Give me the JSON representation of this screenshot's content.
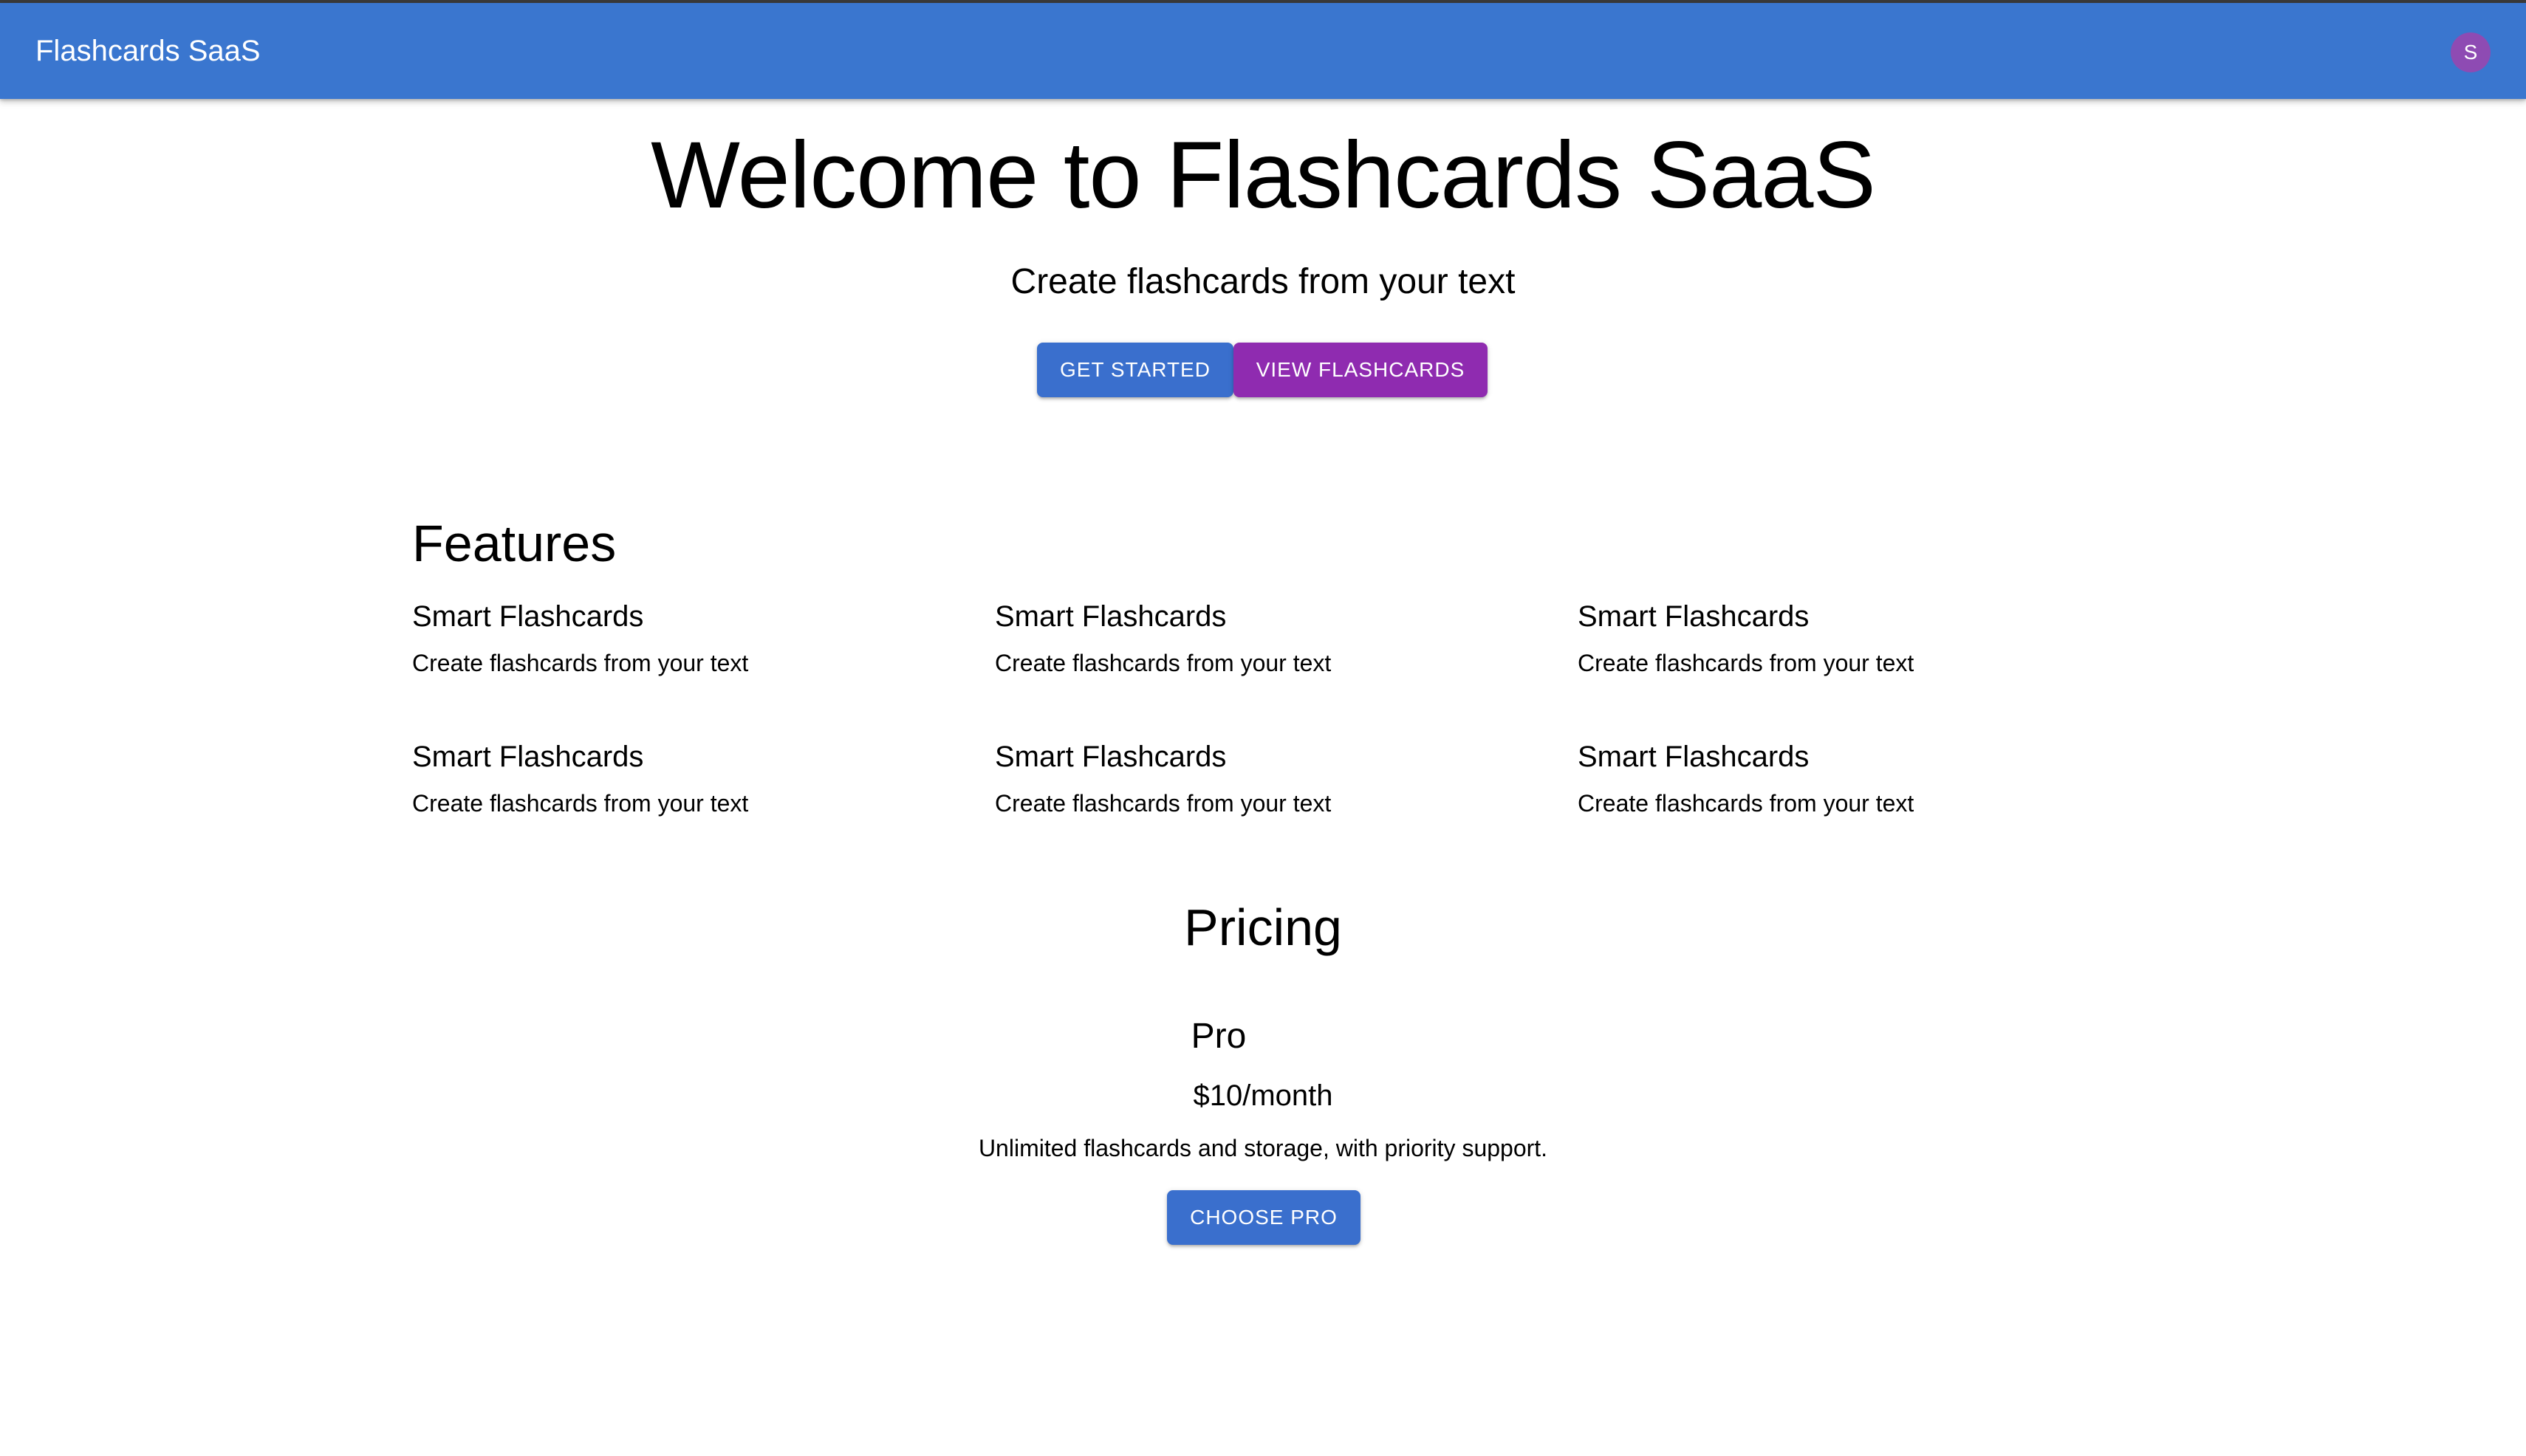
{
  "app": {
    "title": "Flashcards SaaS",
    "avatar_initial": "S"
  },
  "hero": {
    "title": "Welcome to Flashcards SaaS",
    "subtitle": "Create flashcards from your text",
    "get_started_label": "GET STARTED",
    "view_flashcards_label": "VIEW FLASHCARDS"
  },
  "features": {
    "heading": "Features",
    "items": [
      {
        "title": "Smart Flashcards",
        "description": "Create flashcards from your text"
      },
      {
        "title": "Smart Flashcards",
        "description": "Create flashcards from your text"
      },
      {
        "title": "Smart Flashcards",
        "description": "Create flashcards from your text"
      },
      {
        "title": "Smart Flashcards",
        "description": "Create flashcards from your text"
      },
      {
        "title": "Smart Flashcards",
        "description": "Create flashcards from your text"
      },
      {
        "title": "Smart Flashcards",
        "description": "Create flashcards from your text"
      }
    ]
  },
  "pricing": {
    "heading": "Pricing",
    "plan": {
      "name": "Pro",
      "price": "$10/month",
      "description": "Unlimited flashcards and storage, with priority support.",
      "button_label": "CHOOSE PRO"
    }
  },
  "colors": {
    "appbar": "#3a76cf",
    "primary_button": "#3a6fcd",
    "secondary_button": "#8f2bb0",
    "avatar": "#8e4bb3"
  }
}
